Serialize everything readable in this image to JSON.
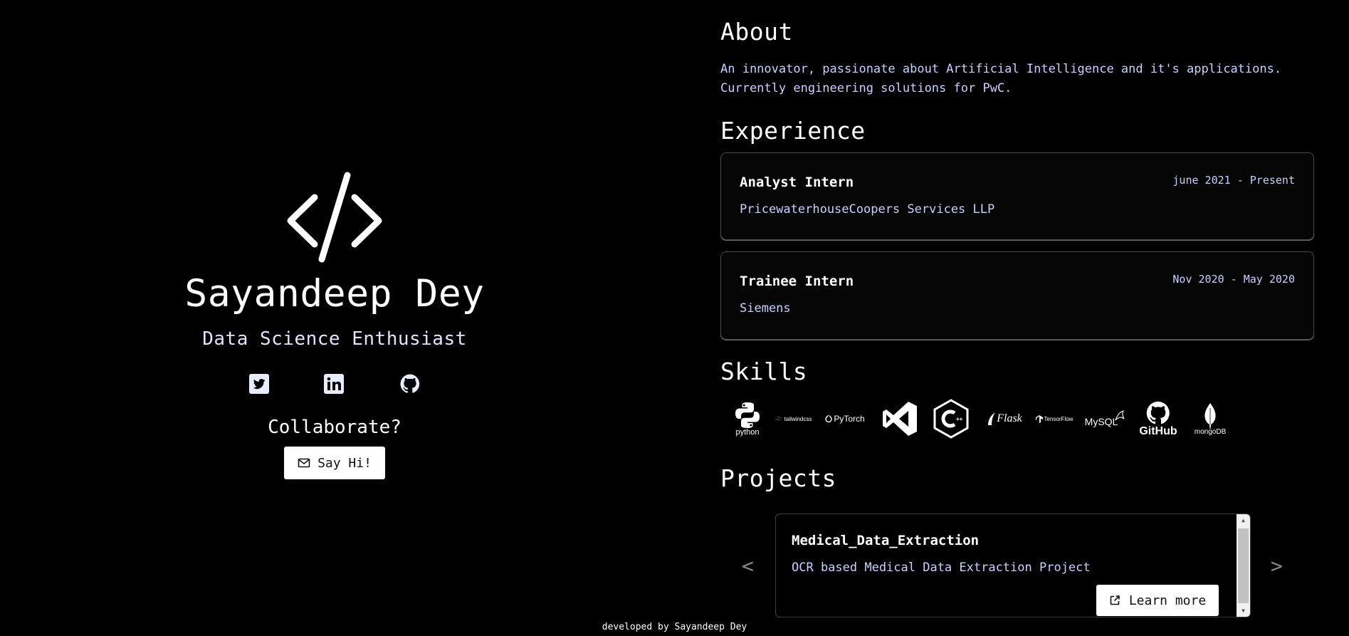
{
  "hero": {
    "name": "Sayandeep Dey",
    "tagline": "Data Science Enthusiast",
    "socials": [
      {
        "name": "twitter",
        "icon": "twitter-icon"
      },
      {
        "name": "linkedin",
        "icon": "linkedin-icon"
      },
      {
        "name": "github",
        "icon": "github-icon"
      }
    ],
    "collab_heading": "Collaborate?",
    "cta_label": "Say Hi!"
  },
  "about": {
    "heading": "About",
    "line1": "An innovator, passionate about Artificial Intelligence and it's applications.",
    "line2": "Currently engineering solutions for PwC."
  },
  "experience": {
    "heading": "Experience",
    "items": [
      {
        "role": "Analyst Intern",
        "company": "PricewaterhouseCoopers Services LLP",
        "dates": "june 2021 - Present"
      },
      {
        "role": "Trainee Intern",
        "company": "Siemens",
        "dates": "Nov 2020 - May 2020"
      }
    ]
  },
  "skills": {
    "heading": "Skills",
    "items": [
      {
        "name": "python",
        "label": "python",
        "icon": "python-icon"
      },
      {
        "name": "tailwindcss",
        "label": "tailwindcss",
        "icon": "tailwindcss-icon"
      },
      {
        "name": "pytorch",
        "label": "PyTorch",
        "icon": "pytorch-icon"
      },
      {
        "name": "vscode",
        "label": "",
        "icon": "vscode-icon"
      },
      {
        "name": "cpp",
        "label": "C++",
        "icon": "cpp-icon"
      },
      {
        "name": "flask",
        "label": "Flask",
        "icon": "flask-icon"
      },
      {
        "name": "tensorflow",
        "label": "TensorFlow",
        "icon": "tensorflow-icon"
      },
      {
        "name": "mysql",
        "label": "MySQL",
        "icon": "mysql-icon"
      },
      {
        "name": "github",
        "label": "GitHub",
        "icon": "github-icon"
      },
      {
        "name": "mongodb",
        "label": "mongoDB",
        "icon": "mongodb-icon"
      }
    ]
  },
  "projects": {
    "heading": "Projects",
    "prev": "<",
    "next": ">",
    "current": {
      "title": "Medical_Data_Extraction",
      "description": "OCR based Medical Data Extraction Project",
      "cta_label": "Learn more"
    }
  },
  "footer": {
    "text": "developed by Sayandeep Dey"
  },
  "colors": {
    "background": "#000000",
    "text": "#ffffff",
    "muted_text": "#c8d0ff",
    "button_bg": "#ffffff"
  }
}
